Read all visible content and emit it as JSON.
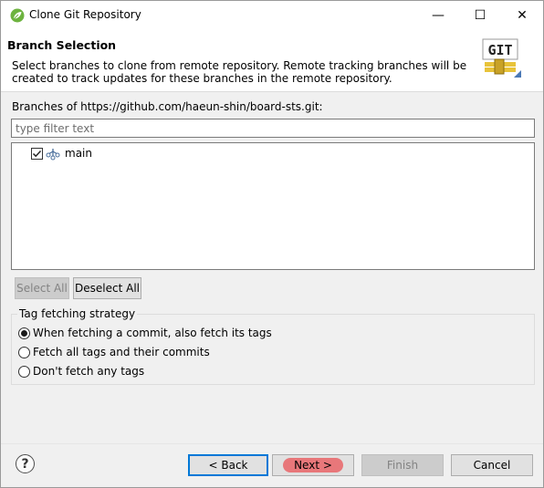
{
  "window": {
    "title": "Clone Git Repository",
    "minimize": "—",
    "maximize": "☐",
    "close": "✕"
  },
  "banner": {
    "title": "Branch Selection",
    "description": "Select branches to clone from remote repository. Remote tracking branches will be created to track updates for these branches in the remote repository.",
    "logo_text": "GIT"
  },
  "branches": {
    "label": "Branches of https://github.com/haeun-shin/board-sts.git:",
    "filter_placeholder": "type filter text",
    "items": [
      {
        "label": "main",
        "checked": true
      }
    ],
    "select_all": "Select All",
    "deselect_all": "Deselect All"
  },
  "tag_strategy": {
    "title": "Tag fetching strategy",
    "options": [
      {
        "label": "When fetching a commit, also fetch its tags",
        "selected": true
      },
      {
        "label": "Fetch all tags and their commits",
        "selected": false
      },
      {
        "label": "Don't fetch any tags",
        "selected": false
      }
    ]
  },
  "footer": {
    "help": "?",
    "back": "< Back",
    "next": "Next >",
    "finish": "Finish",
    "cancel": "Cancel"
  },
  "colors": {
    "accent": "#0078d7",
    "next_highlight": "#e8777a",
    "spring_green": "#6db33f"
  }
}
